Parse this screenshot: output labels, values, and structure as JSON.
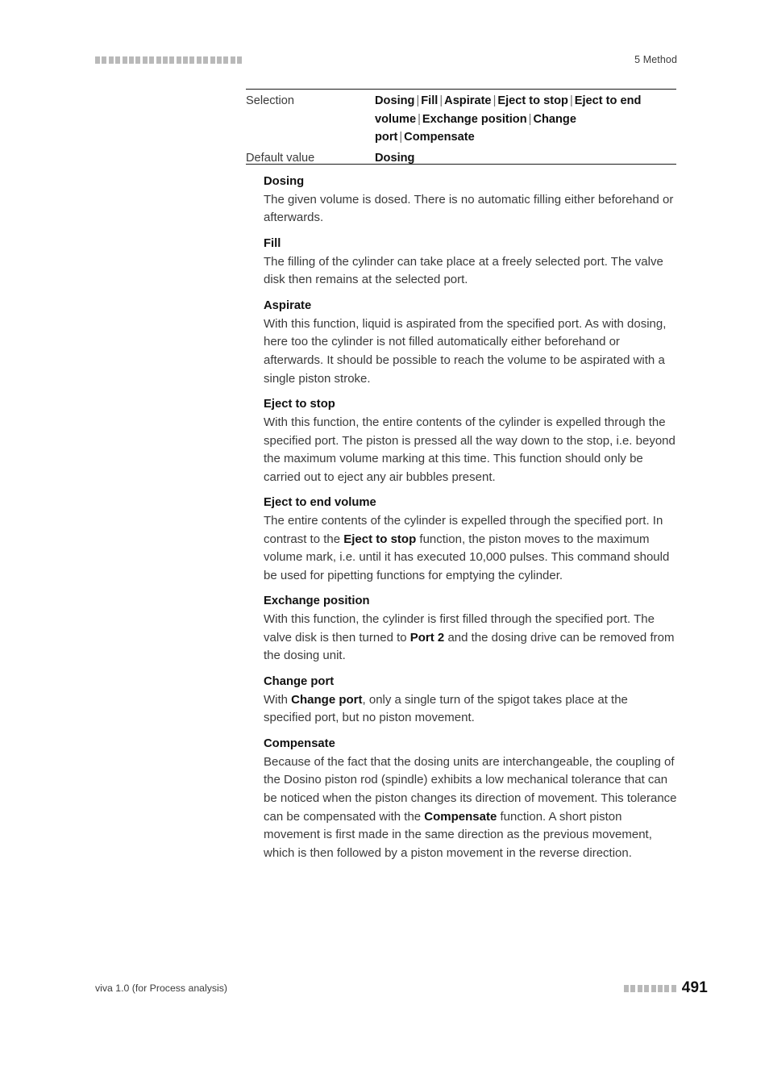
{
  "header": {
    "decoration_squares": 22,
    "chapter": "5 Method"
  },
  "param_table": {
    "rows": [
      {
        "key": "Selection",
        "value_parts": [
          "Dosing",
          "Fill",
          "Aspirate",
          "Eject to stop",
          "Eject to end volume",
          "Exchange position",
          "Change port",
          "Compensate"
        ],
        "separator": "|",
        "value_text": "Dosing | Fill | Aspirate | Eject to stop | Eject to end volume | Exchange position | Change port | Compensate"
      },
      {
        "key": "Default value",
        "value_text": "Dosing"
      }
    ]
  },
  "sections": [
    {
      "title": "Dosing",
      "body_html": "The given volume is dosed. There is no automatic filling either beforehand or afterwards.",
      "body_text": "The given volume is dosed. There is no automatic filling either beforehand or afterwards."
    },
    {
      "title": "Fill",
      "body_html": "The filling of the cylinder can take place at a freely selected port. The valve disk then remains at the selected port.",
      "body_text": "The filling of the cylinder can take place at a freely selected port. The valve disk then remains at the selected port."
    },
    {
      "title": "Aspirate",
      "body_html": "With this function, liquid is aspirated from the specified port. As with dosing, here too the cylinder is not filled automatically either beforehand or afterwards. It should be possible to reach the volume to be aspirated with a single piston stroke.",
      "body_text": "With this function, liquid is aspirated from the specified port. As with dosing, here too the cylinder is not filled automatically either beforehand or afterwards. It should be possible to reach the volume to be aspirated with a single piston stroke."
    },
    {
      "title": "Eject to stop",
      "body_html": "With this function, the entire contents of the cylinder is expelled through the specified port. The piston is pressed all the way down to the stop, i.e. beyond the maximum volume marking at this time. This function should only be carried out to eject any air bubbles present.",
      "body_text": "With this function, the entire contents of the cylinder is expelled through the specified port. The piston is pressed all the way down to the stop, i.e. beyond the maximum volume marking at this time. This function should only be carried out to eject any air bubbles present."
    },
    {
      "title": "Eject to end volume",
      "body_html": "The entire contents of the cylinder is expelled through the specified port. In contrast to the <b>Eject to stop</b> function, the piston moves to the maximum volume mark, i.e. until it has executed 10,000 pulses. This command should be used for pipetting functions for emptying the cylinder.",
      "body_text": "The entire contents of the cylinder is expelled through the specified port. In contrast to the Eject to stop function, the piston moves to the maximum volume mark, i.e. until it has executed 10,000 pulses. This command should be used for pipetting functions for emptying the cylinder."
    },
    {
      "title": "Exchange position",
      "body_html": "With this function, the cylinder is first filled through the specified port. The valve disk is then turned to <b>Port 2</b> and the dosing drive can be removed from the dosing unit.",
      "body_text": "With this function, the cylinder is first filled through the specified port. The valve disk is then turned to Port 2 and the dosing drive can be removed from the dosing unit."
    },
    {
      "title": "Change port",
      "body_html": "With <b>Change port</b>, only a single turn of the spigot takes place at the specified port, but no piston movement.",
      "body_text": "With Change port, only a single turn of the spigot takes place at the specified port, but no piston movement."
    },
    {
      "title": "Compensate",
      "body_html": "Because of the fact that the dosing units are interchangeable, the coupling of the Dosino piston rod (spindle) exhibits a low mechanical tolerance that can be noticed when the piston changes its direction of movement. This tolerance can be compensated with the <b>Compensate</b> function. A short piston movement is first made in the same direction as the previous movement, which is then followed by a piston movement in the reverse direction.",
      "body_text": "Because of the fact that the dosing units are interchangeable, the coupling of the Dosino piston rod (spindle) exhibits a low mechanical tolerance that can be noticed when the piston changes its direction of movement. This tolerance can be compensated with the Compensate function. A short piston movement is first made in the same direction as the previous movement, which is then followed by a piston movement in the reverse direction."
    }
  ],
  "footer": {
    "product": "viva 1.0 (for Process analysis)",
    "decoration_squares": 8,
    "page_number": "491"
  },
  "colors": {
    "body_text": "#3a3a3a",
    "heading_text": "#111111",
    "rule": "#1a1a1a",
    "decoration_square": "#b9b9b9",
    "background": "#ffffff"
  }
}
